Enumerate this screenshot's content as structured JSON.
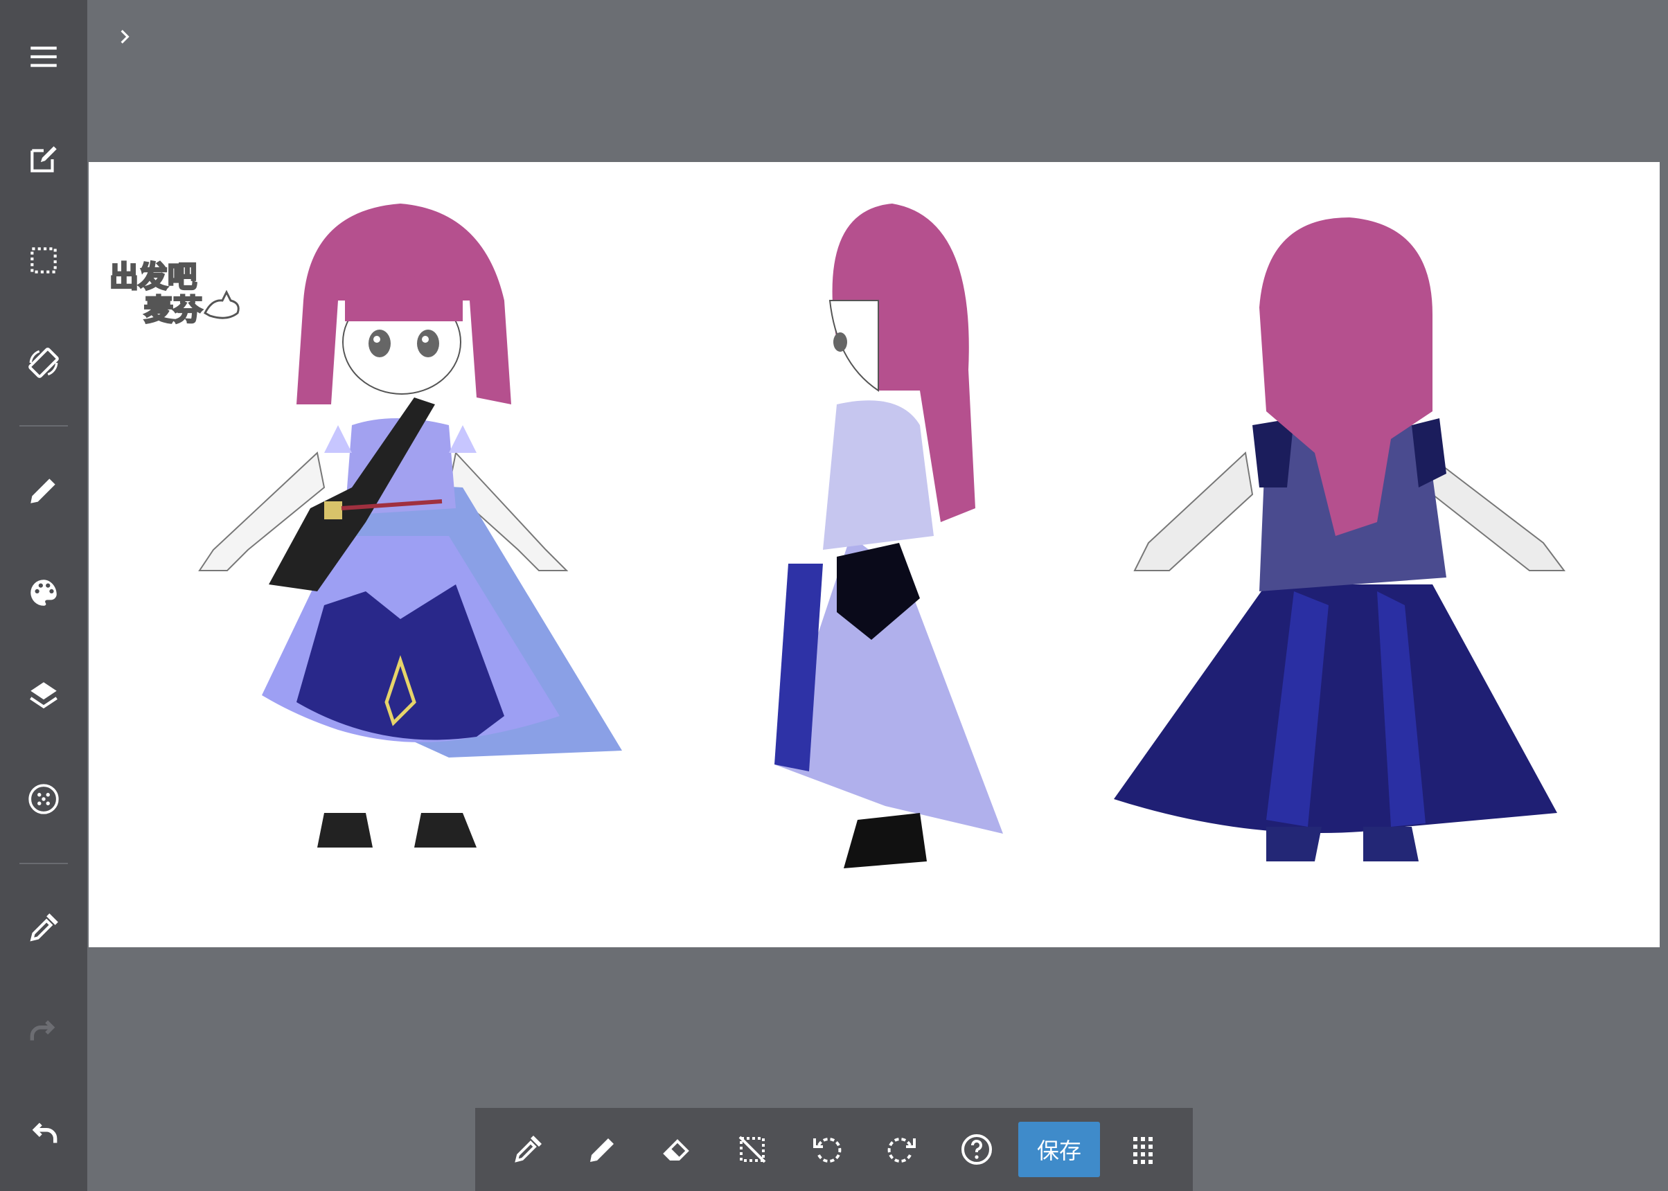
{
  "sidebar": {
    "items": [
      {
        "icon": "menu-icon"
      },
      {
        "icon": "edit-icon"
      },
      {
        "icon": "selection-icon"
      },
      {
        "icon": "rotate-canvas-icon"
      },
      {
        "icon": "pencil-icon"
      },
      {
        "icon": "palette-icon"
      },
      {
        "icon": "layers-icon"
      },
      {
        "icon": "grid-dots-icon"
      },
      {
        "icon": "eyedropper-icon"
      },
      {
        "icon": "redo-icon",
        "disabled": true
      },
      {
        "icon": "undo-icon"
      }
    ]
  },
  "canvas": {
    "watermark_line1": "出发吧",
    "watermark_line2": "麦芬"
  },
  "toolbar": {
    "tools": [
      "eyedropper-icon",
      "pencil-icon",
      "eraser-icon",
      "deselect-icon",
      "undo-icon",
      "redo-icon",
      "help-icon"
    ],
    "save_label": "保存",
    "more_icon": "apps-grid-icon"
  },
  "colors": {
    "sidebar": "#4c4d51",
    "workspace": "#6b6e73",
    "toolbar": "#505155",
    "accent": "#3f8bca",
    "hair": "#b5508e",
    "dress_dark": "#2a2b85",
    "dress_light": "#9a9be8"
  }
}
